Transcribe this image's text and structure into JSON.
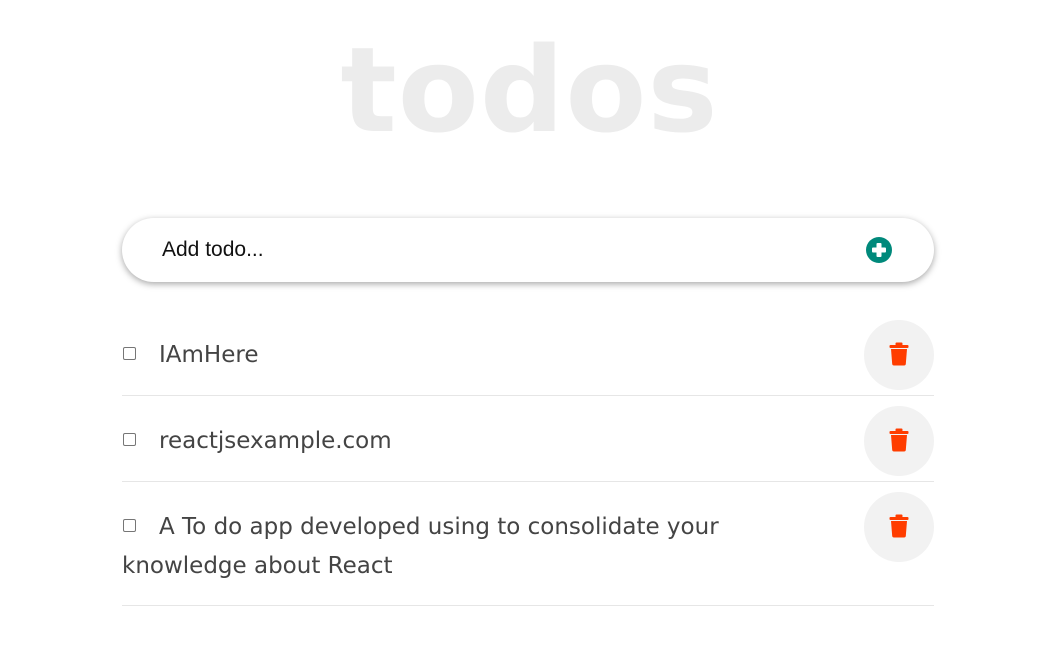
{
  "app": {
    "title": "todos"
  },
  "add_form": {
    "placeholder": "Add todo...",
    "add_icon": "plus-circle-icon"
  },
  "todos": [
    {
      "text": "IAmHere",
      "completed": false,
      "delete_icon": "trash-icon"
    },
    {
      "text": "reactjsexample.com",
      "completed": false,
      "delete_icon": "trash-icon"
    },
    {
      "text": "A To do app developed using to consolidate your knowledge about React",
      "completed": false,
      "delete_icon": "trash-icon"
    }
  ],
  "colors": {
    "title": "#ececec",
    "accent_add": "#00897b",
    "delete": "#ff3d00",
    "delete_bg": "#f2f2f2",
    "text": "#444444",
    "divider": "#e6e6e6"
  }
}
